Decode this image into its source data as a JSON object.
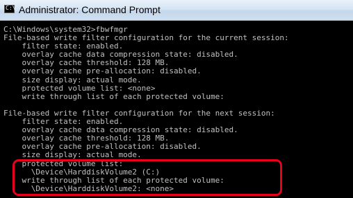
{
  "window": {
    "title": "Administrator: Command Prompt",
    "icon": "cmd-icon",
    "icon_prompt": "C:\\_"
  },
  "console": {
    "lines": [
      "C:\\Windows\\system32>fbwfmgr",
      "File-based write filter configuration for the current session:",
      "    filter state: enabled.",
      "    overlay cache data compression state: disabled.",
      "    overlay cache threshold: 128 MB.",
      "    overlay cache pre-allocation: disabled.",
      "    size display: actual mode.",
      "    protected volume list: <none>",
      "    write through list of each protected volume:",
      "",
      "File-based write filter configuration for the next session:",
      "    filter state: enabled.",
      "    overlay cache data compression state: disabled.",
      "    overlay cache threshold: 128 MB.",
      "    overlay cache pre-allocation: disabled.",
      "    size display: actual mode.",
      "    protected volume list:",
      "      \\Device\\HarddiskVolume2 (C:)",
      "    write through list of each protected volume:",
      "      \\Device\\HarddiskVolume2: <none>"
    ]
  },
  "colors": {
    "console_background": "#000000",
    "console_text": "#c0c0c0",
    "highlight_border": "#e8001c"
  }
}
